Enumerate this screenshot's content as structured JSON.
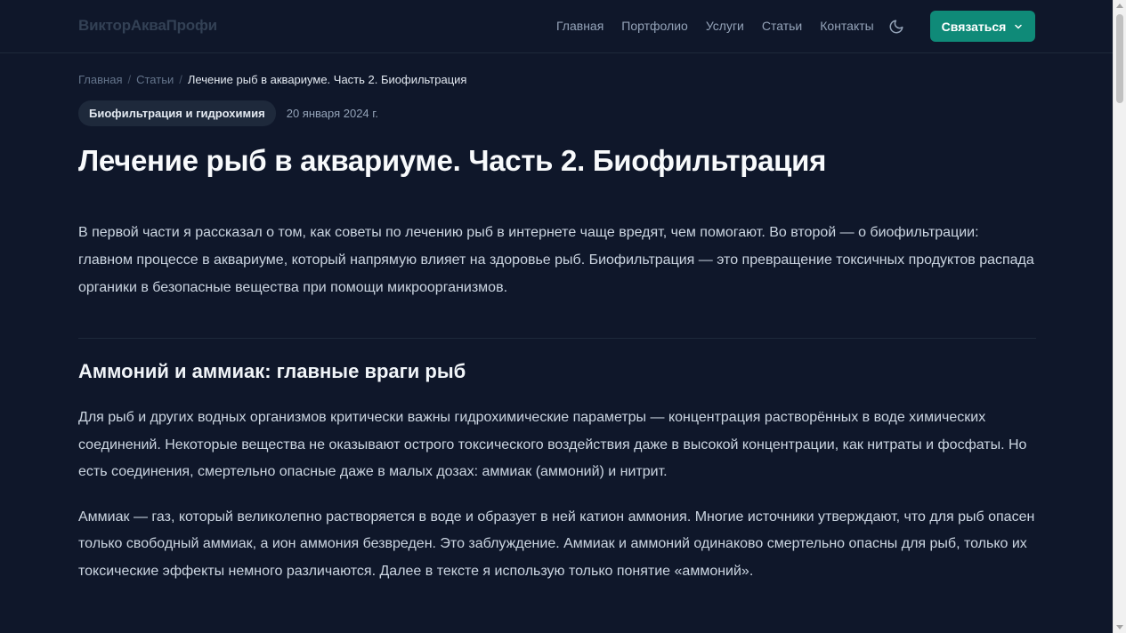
{
  "header": {
    "logo": "ВикторАкваПрофи",
    "nav": [
      "Главная",
      "Портфолио",
      "Услуги",
      "Статьи",
      "Контакты"
    ],
    "theme_icon": "moon-icon",
    "contact_label": "Связаться",
    "accent_color": "#0f8a78"
  },
  "breadcrumb": {
    "home": "Главная",
    "section": "Статьи",
    "current": "Лечение рыб в аквариуме. Часть 2. Биофильтрация"
  },
  "article": {
    "tag": "Биофильтрация и гидрохимия",
    "date": "20 января 2024 г.",
    "title": "Лечение рыб в аквариуме. Часть 2. Биофильтрация",
    "lead": "В первой части я рассказал о том, как советы по лечению рыб в интернете чаще вредят, чем помогают. Во второй — о биофильтрации: главном процессе в аквариуме, который напрямую влияет на здоровье рыб. Биофильтрация — это превращение токсичных продуктов распада органики в безопасные вещества при помощи микроорганизмов.",
    "section_title": "Аммоний и аммиак: главные враги рыб",
    "paragraph_1": "Для рыб и других водных организмов критически важны гидрохимические параметры — концентрация растворённых в воде химических соединений. Некоторые вещества не оказывают острого токсического воздействия даже в высокой концентрации, как нитраты и фосфаты. Но есть соединения, смертельно опасные даже в малых дозах: аммиак (аммоний) и нитрит.",
    "paragraph_2": "Аммиак — газ, который великолепно растворяется в воде и образует в ней катион аммония. Многие источники утверждают, что для рыб опасен только свободный аммиак, а ион аммония безвреден. Это заблуждение. Аммиак и аммоний одинаково смертельно опасны для рыб, только их токсические эффекты немного различаются. Далее в тексте я использую только понятие «аммоний»."
  }
}
